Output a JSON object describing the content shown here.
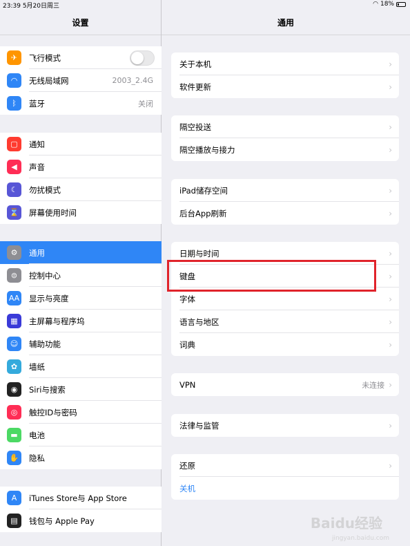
{
  "status": {
    "time": "23:39",
    "date": "5月20日周三",
    "battery": "18%"
  },
  "left": {
    "title": "设置",
    "group1": [
      {
        "label": "飞行模式",
        "icon": "airplane-icon",
        "color": "#ff9500",
        "glyph": "✈",
        "toggle": true
      },
      {
        "label": "无线局域网",
        "icon": "wifi-icon",
        "color": "#2f86f6",
        "glyph": "◠",
        "value": "2003_2.4G"
      },
      {
        "label": "蓝牙",
        "icon": "bluetooth-icon",
        "color": "#2f86f6",
        "glyph": "ᛒ",
        "value": "关闭"
      }
    ],
    "group2": [
      {
        "label": "通知",
        "icon": "notification-icon",
        "color": "#ff3b30",
        "glyph": "▢"
      },
      {
        "label": "声音",
        "icon": "sound-icon",
        "color": "#ff2d55",
        "glyph": "◀"
      },
      {
        "label": "勿扰模式",
        "icon": "moon-icon",
        "color": "#5856d6",
        "glyph": "☾"
      },
      {
        "label": "屏幕使用时间",
        "icon": "hourglass-icon",
        "color": "#5856d6",
        "glyph": "⌛"
      }
    ],
    "group3": [
      {
        "label": "通用",
        "icon": "gear-icon",
        "color": "#8e8e93",
        "glyph": "⚙",
        "selected": true
      },
      {
        "label": "控制中心",
        "icon": "control-center-icon",
        "color": "#8e8e93",
        "glyph": "⊜"
      },
      {
        "label": "显示与亮度",
        "icon": "display-icon",
        "color": "#2f86f6",
        "glyph": "AA"
      },
      {
        "label": "主屏幕与程序坞",
        "icon": "home-screen-icon",
        "color": "#3a3ad8",
        "glyph": "▦"
      },
      {
        "label": "辅助功能",
        "icon": "accessibility-icon",
        "color": "#2f86f6",
        "glyph": "☺"
      },
      {
        "label": "墙纸",
        "icon": "wallpaper-icon",
        "color": "#34aadc",
        "glyph": "✿"
      },
      {
        "label": "Siri与搜索",
        "icon": "siri-icon",
        "color": "#222",
        "glyph": "◉"
      },
      {
        "label": "触控ID与密码",
        "icon": "fingerprint-icon",
        "color": "#ff2d55",
        "glyph": "◎"
      },
      {
        "label": "电池",
        "icon": "battery-icon",
        "color": "#4cd964",
        "glyph": "▬"
      },
      {
        "label": "隐私",
        "icon": "hand-icon",
        "color": "#2f86f6",
        "glyph": "✋"
      }
    ],
    "group4": [
      {
        "label": "iTunes Store与 App Store",
        "icon": "app-store-icon",
        "color": "#2f86f6",
        "glyph": "A"
      },
      {
        "label": "钱包与 Apple Pay",
        "icon": "wallet-icon",
        "color": "#222",
        "glyph": "▤"
      }
    ]
  },
  "right": {
    "title": "通用",
    "groups": [
      [
        {
          "label": "关于本机"
        },
        {
          "label": "软件更新"
        }
      ],
      [
        {
          "label": "隔空投送"
        },
        {
          "label": "隔空播放与接力"
        }
      ],
      [
        {
          "label": "iPad储存空间"
        },
        {
          "label": "后台App刷新"
        }
      ],
      [
        {
          "label": "日期与时间"
        },
        {
          "label": "键盘"
        },
        {
          "label": "字体"
        },
        {
          "label": "语言与地区"
        },
        {
          "label": "词典"
        }
      ],
      [
        {
          "label": "VPN",
          "value": "未连接"
        }
      ],
      [
        {
          "label": "法律与监管"
        }
      ],
      [
        {
          "label": "还原"
        },
        {
          "label": "关机",
          "blue": true,
          "nochev": true
        }
      ]
    ]
  },
  "watermark": {
    "text": "Baidu经验",
    "sub": "jingyan.baidu.com"
  }
}
